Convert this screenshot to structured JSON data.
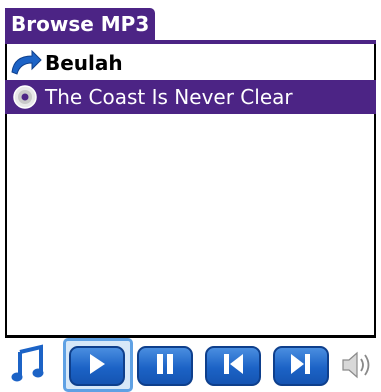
{
  "title": "Browse MP3",
  "list": {
    "back_label": "Beulah",
    "selected_label": "The Coast Is Never Clear"
  },
  "icons": {
    "back": "curved-back-arrow-icon",
    "disc": "cd-icon",
    "music": "music-note-icon",
    "play": "play-icon",
    "pause": "pause-icon",
    "prev": "previous-track-icon",
    "next": "next-track-icon",
    "volume": "volume-icon"
  },
  "colors": {
    "accent": "#4c2485",
    "button": "#1c63c6",
    "highlight": "#5fa1e4"
  }
}
